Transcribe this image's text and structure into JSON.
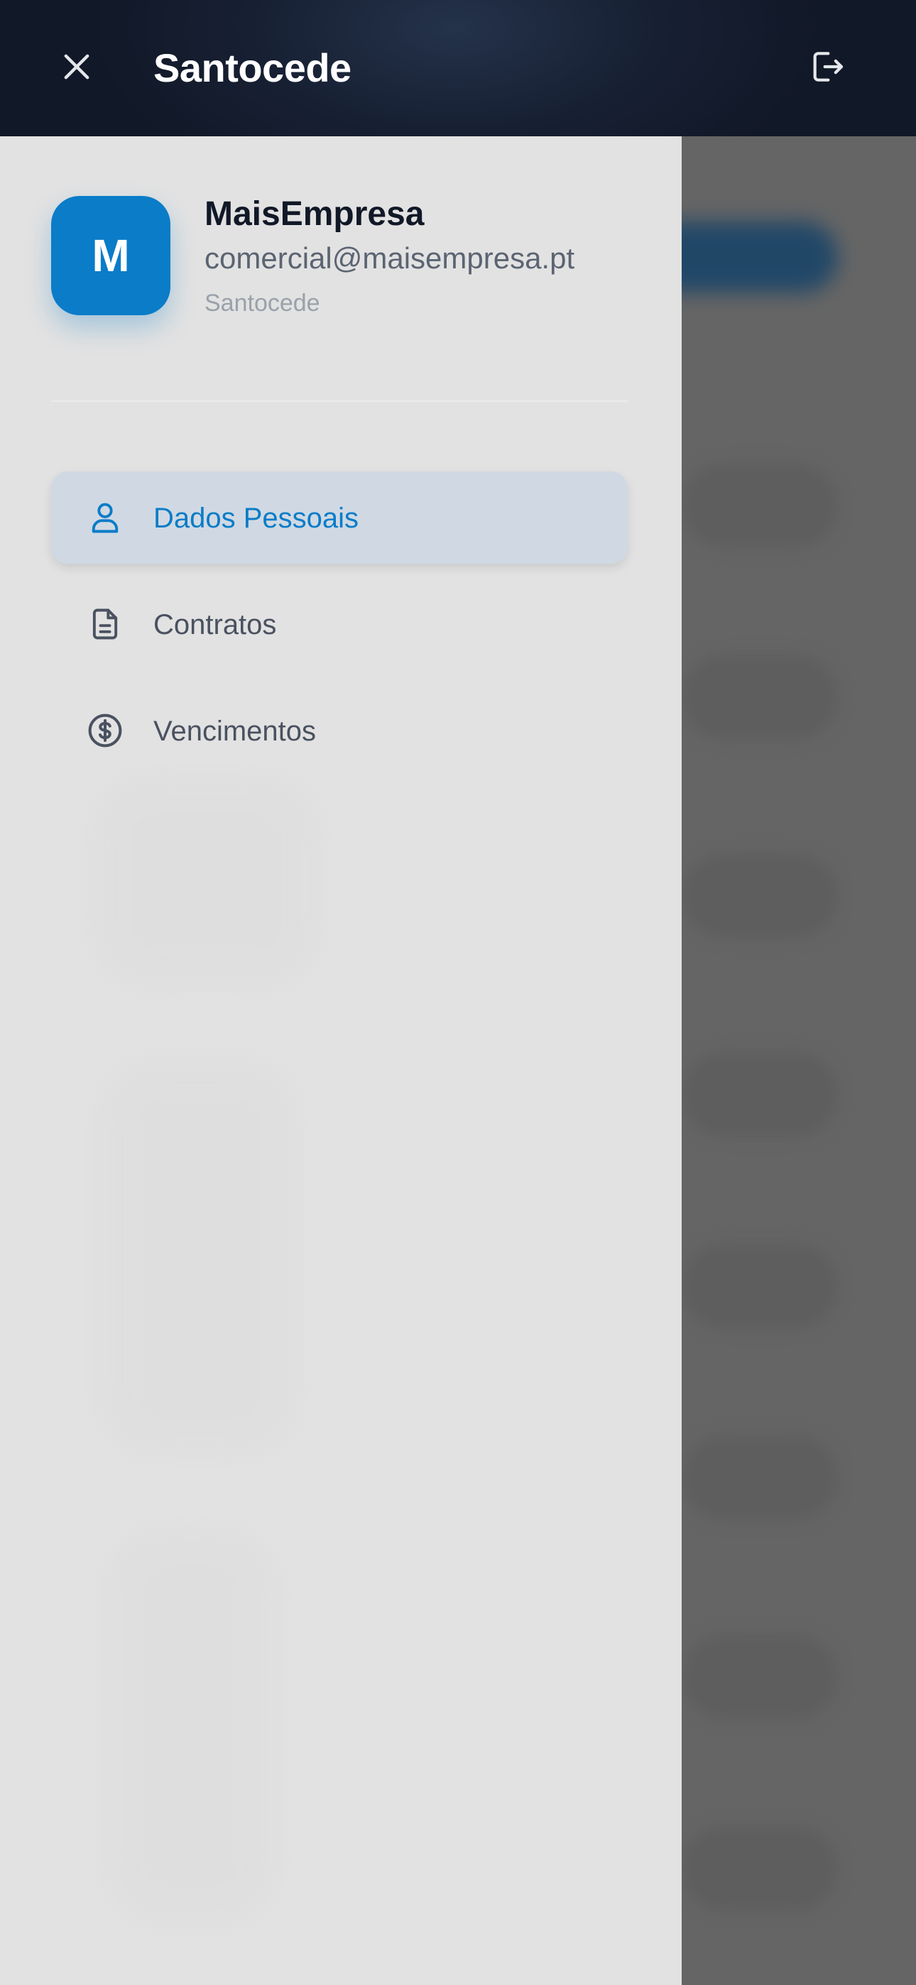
{
  "header": {
    "title": "Santocede",
    "close_icon": "close-icon",
    "logout_icon": "logout-icon",
    "background_color": "#111827"
  },
  "profile": {
    "avatar_initial": "M",
    "name": "MaisEmpresa",
    "email": "comercial@maisempresa.pt",
    "company": "Santocede",
    "avatar_color": "#0a7cc8"
  },
  "menu": {
    "items": [
      {
        "label": "Dados Pessoais",
        "icon": "user-icon",
        "active": true
      },
      {
        "label": "Contratos",
        "icon": "document-icon",
        "active": false
      },
      {
        "label": "Vencimentos",
        "icon": "dollar-circle-icon",
        "active": false
      }
    ]
  },
  "colors": {
    "accent": "#0a7cc8",
    "drawer_bg": "#e2e2e2",
    "overlay": "#656565",
    "active_item_bg": "#d0d9e3"
  }
}
